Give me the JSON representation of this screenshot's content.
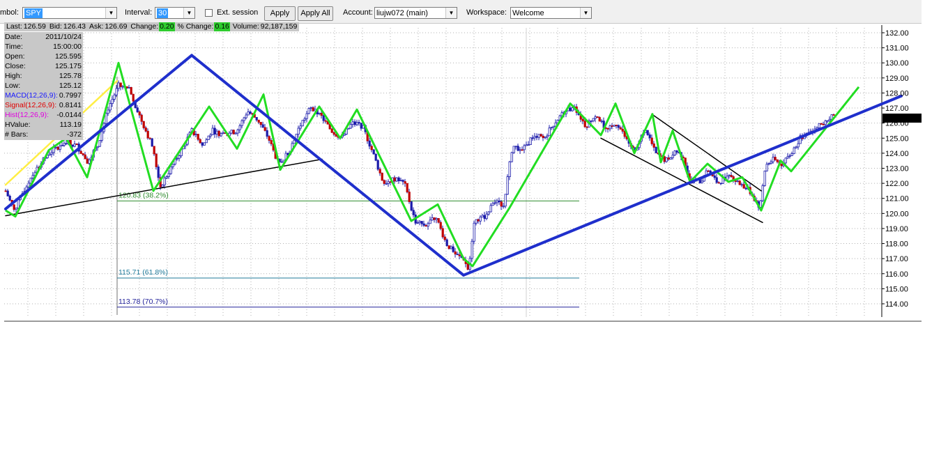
{
  "toolbar": {
    "symbol_label": "mbol:",
    "symbol_value": "SPY",
    "interval_label": "Interval:",
    "interval_value": "30",
    "ext_session_label": "Ext. session",
    "apply_label": "Apply",
    "apply_all_label": "Apply All",
    "account_label": "Account:",
    "account_value": "liujw072 (main)",
    "workspace_label": "Workspace:",
    "workspace_value": "Welcome"
  },
  "quote": {
    "last_label": "Last:",
    "last": "126.59",
    "bid_label": "Bid:",
    "bid": "126.43",
    "ask_label": "Ask:",
    "ask": "126.69",
    "change_label": "Change:",
    "change": "0.20",
    "pct_change_label": "% Change:",
    "pct_change": "0.16",
    "volume_label": "Volume:",
    "volume": "92,187,159"
  },
  "info": [
    {
      "key": "Date:",
      "value": "2011/10/24",
      "color": "#000000"
    },
    {
      "key": "Time:",
      "value": "15:00:00",
      "color": "#000000"
    },
    {
      "key": "Open:",
      "value": "125.595",
      "color": "#000000"
    },
    {
      "key": "Close:",
      "value": "125.175",
      "color": "#000000"
    },
    {
      "key": "High:",
      "value": "125.78",
      "color": "#000000"
    },
    {
      "key": "Low:",
      "value": "125.12",
      "color": "#000000"
    },
    {
      "key": "MACD(12,26,9):",
      "value": "0.7997",
      "color": "#1a1aff"
    },
    {
      "key": "Signal(12,26,9):",
      "value": "0.8141",
      "color": "#e00000"
    },
    {
      "key": "Hist(12,26,9):",
      "value": "-0.0144",
      "color": "#e000e0"
    },
    {
      "key": "HValue:",
      "value": "113.19",
      "color": "#000000"
    },
    {
      "key": "# Bars:",
      "value": "-372",
      "color": "#000000"
    }
  ],
  "chart": {
    "last_price": "126.38",
    "price_range": [
      113.4,
      132.5
    ],
    "y_ticks": [
      "114.00",
      "115.00",
      "116.00",
      "117.00",
      "118.00",
      "119.00",
      "120.00",
      "121.00",
      "122.00",
      "123.00",
      "124.00",
      "125.00",
      "126.00",
      "127.00",
      "128.00",
      "129.00",
      "130.00",
      "131.00",
      "132.00"
    ],
    "fib_levels": [
      {
        "label": "120.83 (38.2%)",
        "price": 120.83,
        "color": "#2e8b2e"
      },
      {
        "label": "115.71 (61.8%)",
        "price": 115.71,
        "color": "#1f7a9a"
      },
      {
        "label": "113.78 (70.7%)",
        "price": 113.78,
        "color": "#22229a"
      }
    ],
    "colors": {
      "up": "#1a1aaa",
      "down": "#c00000",
      "zigzag": "#22dd22",
      "trend": "#1f2fcc",
      "channel": "#000000",
      "yellow": "#ffee44",
      "grid": "#b0b0b0"
    }
  }
}
